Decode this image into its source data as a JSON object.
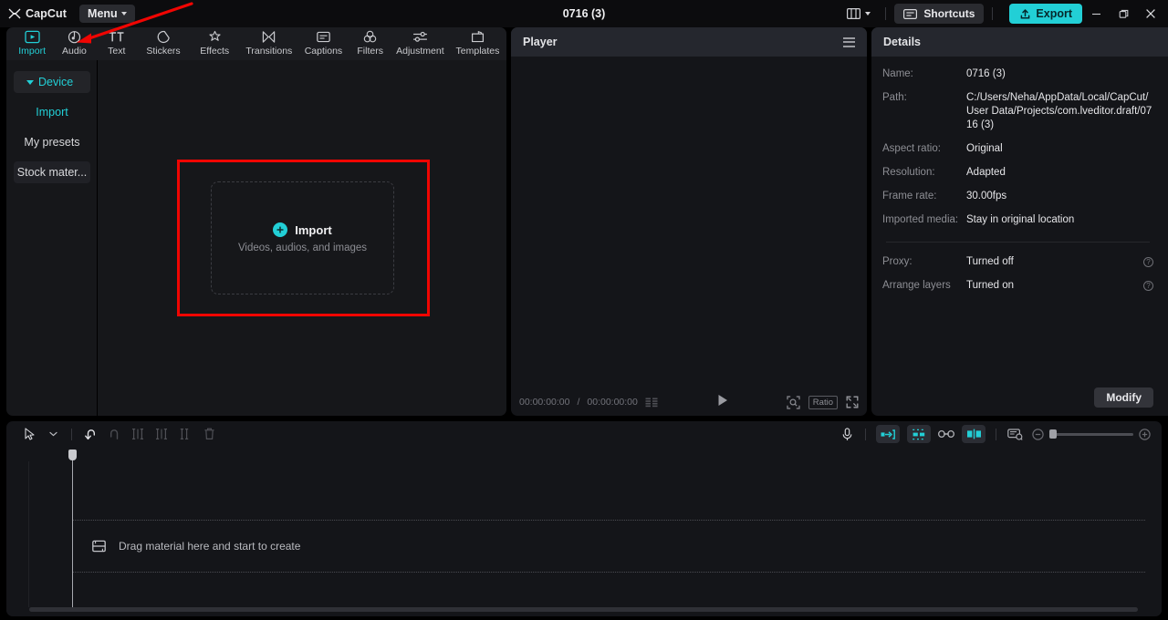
{
  "app": {
    "brand": "CapCut",
    "menu_label": "Menu",
    "project_title": "0716 (3)"
  },
  "titlebar": {
    "layout_icon": "layout-grid-icon",
    "layout_caret_icon": "chevron-down-icon",
    "shortcuts_label": "Shortcuts",
    "shortcuts_icon": "keyboard-icon",
    "export_label": "Export",
    "export_icon": "upload-icon",
    "export_color": "#22cfd6",
    "minimize_icon": "minimize-icon",
    "maximize_icon": "maximize-icon",
    "close_icon": "close-icon"
  },
  "nav_tabs": [
    {
      "label": "Import",
      "icon": "import-media-icon",
      "active": true
    },
    {
      "label": "Audio",
      "icon": "audio-disc-icon",
      "active": false
    },
    {
      "label": "Text",
      "icon": "text-tt-icon",
      "active": false
    },
    {
      "label": "Stickers",
      "icon": "sticker-icon",
      "active": false
    },
    {
      "label": "Effects",
      "icon": "effects-star-icon",
      "active": false
    },
    {
      "label": "Transitions",
      "icon": "transitions-icon",
      "active": false
    },
    {
      "label": "Captions",
      "icon": "captions-icon",
      "active": false
    },
    {
      "label": "Filters",
      "icon": "filters-circles-icon",
      "active": false
    },
    {
      "label": "Adjustment",
      "icon": "adjustment-sliders-icon",
      "active": false
    },
    {
      "label": "Templates",
      "icon": "templates-icon",
      "active": false
    }
  ],
  "sidebar": {
    "items": [
      {
        "label": "Device",
        "name": "device",
        "selected": true
      },
      {
        "label": "Import",
        "name": "import",
        "selected": false
      },
      {
        "label": "My presets",
        "name": "my-presets",
        "selected": false
      },
      {
        "label": "Stock mater...",
        "name": "stock-material",
        "selected": false
      }
    ]
  },
  "import_area": {
    "title": "Import",
    "subtitle": "Videos, audios, and images",
    "plus_icon": "plus-circle-icon",
    "highlight_color": "#f00502"
  },
  "annotation": {
    "arrow_color": "#f00502",
    "points_to": "audio-tab"
  },
  "player": {
    "title": "Player",
    "menu_icon": "hamburger-menu-icon",
    "current_time": "00:00:00:00",
    "time_separator": "/",
    "total_time": "00:00:00:00",
    "list_icon": "keyframe-list-icon",
    "play_icon": "play-icon",
    "magnifier_icon": "zoom-fit-icon",
    "ratio_label": "Ratio",
    "fullscreen_icon": "fullscreen-icon"
  },
  "details": {
    "title": "Details",
    "rows": [
      {
        "key": "Name:",
        "value": "0716 (3)"
      },
      {
        "key": "Path:",
        "value": "C:/Users/Neha/AppData/Local/CapCut/User Data/Projects/com.lveditor.draft/0716 (3)"
      },
      {
        "key": "Aspect ratio:",
        "value": "Original"
      },
      {
        "key": "Resolution:",
        "value": "Adapted"
      },
      {
        "key": "Frame rate:",
        "value": "30.00fps"
      },
      {
        "key": "Imported media:",
        "value": "Stay in original location"
      }
    ],
    "toggles": [
      {
        "key": "Proxy:",
        "value": "Turned off",
        "info_icon": "info-icon"
      },
      {
        "key": "Arrange layers",
        "value": "Turned on",
        "info_icon": "info-icon"
      }
    ],
    "modify_label": "Modify"
  },
  "timeline": {
    "tools_left": [
      {
        "name": "select-cursor",
        "icon": "cursor-arrow-icon",
        "state": "active"
      },
      {
        "name": "cursor-dropdown",
        "icon": "chevron-down-icon",
        "state": "active"
      },
      {
        "name": "undo",
        "icon": "undo-icon",
        "state": "active"
      },
      {
        "name": "redo",
        "icon": "redo-icon",
        "state": "disabled"
      },
      {
        "name": "split",
        "icon": "split-icon",
        "state": "disabled"
      },
      {
        "name": "trim-left",
        "icon": "trim-left-icon",
        "state": "disabled"
      },
      {
        "name": "trim-right",
        "icon": "trim-right-icon",
        "state": "disabled"
      },
      {
        "name": "delete",
        "icon": "trash-icon",
        "state": "disabled"
      }
    ],
    "tools_right": [
      {
        "name": "record-voiceover",
        "icon": "microphone-icon",
        "state": "normal"
      },
      {
        "name": "auto-fill",
        "icon": "auto-fill-icon",
        "state": "toggled"
      },
      {
        "name": "snap-magnet",
        "icon": "snap-magnet-icon",
        "state": "toggled"
      },
      {
        "name": "link-clips",
        "icon": "link-icon",
        "state": "normal"
      },
      {
        "name": "mirror-preview",
        "icon": "mirror-split-icon",
        "state": "toggled"
      },
      {
        "name": "render-preview",
        "icon": "render-preview-icon",
        "state": "normal"
      }
    ],
    "zoom_out_icon": "zoom-out-icon",
    "zoom_in_icon": "zoom-in-icon",
    "zoom_value": 0,
    "drop_hint": "Drag material here and start to create",
    "drop_icon": "film-strip-icon",
    "playhead_position": "00:00:00:00"
  }
}
